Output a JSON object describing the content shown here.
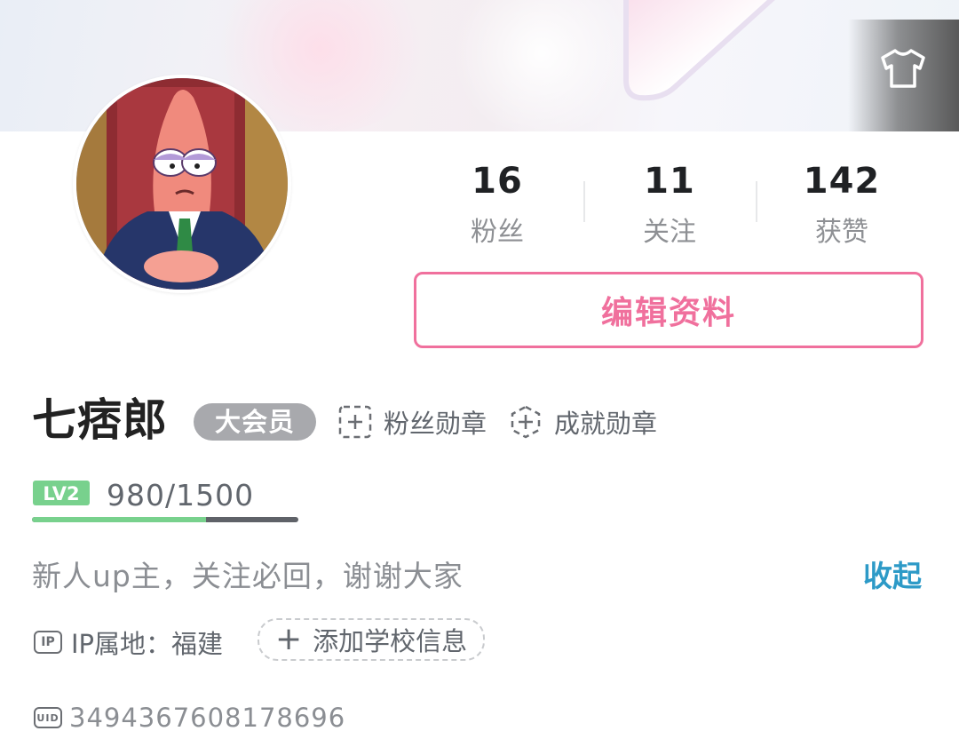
{
  "stats": [
    {
      "value": "16",
      "label": "粉丝"
    },
    {
      "value": "11",
      "label": "关注"
    },
    {
      "value": "142",
      "label": "获赞"
    }
  ],
  "edit_button": "编辑资料",
  "profile": {
    "name": "七痞郎",
    "vip_badge": "大会员",
    "fan_medal": "粉丝勋章",
    "achievement_medal": "成就勋章"
  },
  "level": {
    "badge": "LV2",
    "progress_text": "980/1500",
    "progress_fraction": 0.653
  },
  "bio": {
    "text": "新人up主，关注必回，谢谢大家",
    "collapse_label": "收起"
  },
  "ip": {
    "icon_text": "IP",
    "text": "IP属地：福建"
  },
  "school": {
    "label": "添加学校信息"
  },
  "uid": {
    "icon_text": "UID",
    "value": "3494367608178696"
  },
  "icons": {
    "skin": "tshirt-icon",
    "medal": "medal-plus-icon",
    "add": "plus-icon"
  },
  "colors": {
    "accent_pink": "#f0709d",
    "link_blue": "#2d9ac7",
    "level_green": "#78d18d",
    "vip_gray": "#a8a9ad"
  }
}
